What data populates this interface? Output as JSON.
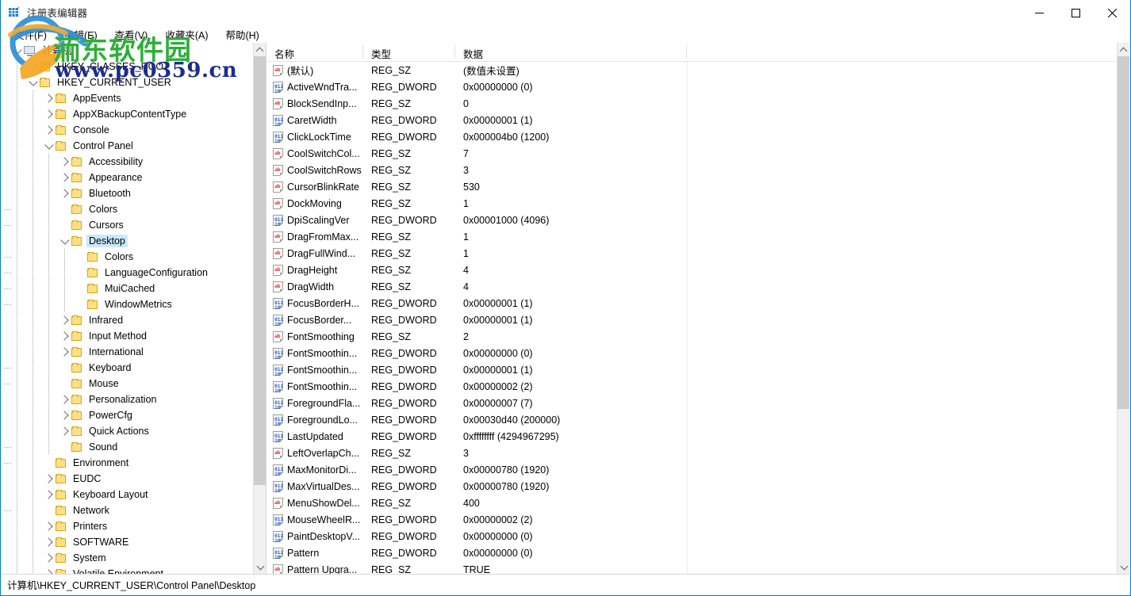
{
  "window": {
    "title": "注册表编辑器",
    "icon": "registry-icon",
    "minimize_label": "–",
    "maximize_label": "□",
    "close_label": "✕"
  },
  "menubar": {
    "items": [
      {
        "label": "文件(F)",
        "key": "F"
      },
      {
        "label": "编辑(E)",
        "key": "E"
      },
      {
        "label": "查看(V)",
        "key": "V"
      },
      {
        "label": "收藏夹(A)",
        "key": "A"
      },
      {
        "label": "帮助(H)",
        "key": "H"
      }
    ]
  },
  "tree": {
    "nodes": [
      {
        "label": "计算机",
        "depth": 0,
        "expander": "down",
        "icon": "computer-icon",
        "selected": false
      },
      {
        "label": "HKEY_CLASSES_ROOT",
        "depth": 1,
        "expander": "right",
        "icon": "folder-icon",
        "selected": false
      },
      {
        "label": "HKEY_CURRENT_USER",
        "depth": 1,
        "expander": "down",
        "icon": "folder-icon",
        "selected": false
      },
      {
        "label": "AppEvents",
        "depth": 2,
        "expander": "right",
        "icon": "folder-icon",
        "selected": false
      },
      {
        "label": "AppXBackupContentType",
        "depth": 2,
        "expander": "right",
        "icon": "folder-icon",
        "selected": false
      },
      {
        "label": "Console",
        "depth": 2,
        "expander": "right",
        "icon": "folder-icon",
        "selected": false
      },
      {
        "label": "Control Panel",
        "depth": 2,
        "expander": "down",
        "icon": "folder-icon",
        "selected": false
      },
      {
        "label": "Accessibility",
        "depth": 3,
        "expander": "right",
        "icon": "folder-icon",
        "selected": false
      },
      {
        "label": "Appearance",
        "depth": 3,
        "expander": "right",
        "icon": "folder-icon",
        "selected": false
      },
      {
        "label": "Bluetooth",
        "depth": 3,
        "expander": "right",
        "icon": "folder-icon",
        "selected": false
      },
      {
        "label": "Colors",
        "depth": 3,
        "expander": "none",
        "icon": "folder-icon",
        "selected": false
      },
      {
        "label": "Cursors",
        "depth": 3,
        "expander": "none",
        "icon": "folder-icon",
        "selected": false
      },
      {
        "label": "Desktop",
        "depth": 3,
        "expander": "down",
        "icon": "folder-icon",
        "selected": true
      },
      {
        "label": "Colors",
        "depth": 4,
        "expander": "none",
        "icon": "folder-icon",
        "selected": false
      },
      {
        "label": "LanguageConfiguration",
        "depth": 4,
        "expander": "none",
        "icon": "folder-icon",
        "selected": false
      },
      {
        "label": "MuiCached",
        "depth": 4,
        "expander": "none",
        "icon": "folder-icon",
        "selected": false
      },
      {
        "label": "WindowMetrics",
        "depth": 4,
        "expander": "none",
        "icon": "folder-icon",
        "selected": false
      },
      {
        "label": "Infrared",
        "depth": 3,
        "expander": "right",
        "icon": "folder-icon",
        "selected": false
      },
      {
        "label": "Input Method",
        "depth": 3,
        "expander": "right",
        "icon": "folder-icon",
        "selected": false
      },
      {
        "label": "International",
        "depth": 3,
        "expander": "right",
        "icon": "folder-icon",
        "selected": false
      },
      {
        "label": "Keyboard",
        "depth": 3,
        "expander": "none",
        "icon": "folder-icon",
        "selected": false
      },
      {
        "label": "Mouse",
        "depth": 3,
        "expander": "none",
        "icon": "folder-icon",
        "selected": false
      },
      {
        "label": "Personalization",
        "depth": 3,
        "expander": "right",
        "icon": "folder-icon",
        "selected": false
      },
      {
        "label": "PowerCfg",
        "depth": 3,
        "expander": "right",
        "icon": "folder-icon",
        "selected": false
      },
      {
        "label": "Quick Actions",
        "depth": 3,
        "expander": "right",
        "icon": "folder-icon",
        "selected": false
      },
      {
        "label": "Sound",
        "depth": 3,
        "expander": "none",
        "icon": "folder-icon",
        "selected": false
      },
      {
        "label": "Environment",
        "depth": 2,
        "expander": "none",
        "icon": "folder-icon",
        "selected": false
      },
      {
        "label": "EUDC",
        "depth": 2,
        "expander": "right",
        "icon": "folder-icon",
        "selected": false
      },
      {
        "label": "Keyboard Layout",
        "depth": 2,
        "expander": "right",
        "icon": "folder-icon",
        "selected": false
      },
      {
        "label": "Network",
        "depth": 2,
        "expander": "none",
        "icon": "folder-icon",
        "selected": false
      },
      {
        "label": "Printers",
        "depth": 2,
        "expander": "right",
        "icon": "folder-icon",
        "selected": false
      },
      {
        "label": "SOFTWARE",
        "depth": 2,
        "expander": "right",
        "icon": "folder-icon",
        "selected": false
      },
      {
        "label": "System",
        "depth": 2,
        "expander": "right",
        "icon": "folder-icon",
        "selected": false
      },
      {
        "label": "Volatile Environment",
        "depth": 2,
        "expander": "right",
        "icon": "folder-icon",
        "selected": false
      }
    ],
    "scroll_thumb_pct": 85
  },
  "list": {
    "columns": [
      {
        "label": "名称"
      },
      {
        "label": "类型"
      },
      {
        "label": "数据"
      },
      {
        "label": ""
      }
    ],
    "rows": [
      {
        "name": "(默认)",
        "type": "REG_SZ",
        "data": "(数值未设置)",
        "icon": "string-value-icon"
      },
      {
        "name": "ActiveWndTra...",
        "type": "REG_DWORD",
        "data": "0x00000000 (0)",
        "icon": "dword-value-icon"
      },
      {
        "name": "BlockSendInp...",
        "type": "REG_SZ",
        "data": "0",
        "icon": "string-value-icon"
      },
      {
        "name": "CaretWidth",
        "type": "REG_DWORD",
        "data": "0x00000001 (1)",
        "icon": "dword-value-icon"
      },
      {
        "name": "ClickLockTime",
        "type": "REG_DWORD",
        "data": "0x000004b0 (1200)",
        "icon": "dword-value-icon"
      },
      {
        "name": "CoolSwitchCol...",
        "type": "REG_SZ",
        "data": "7",
        "icon": "string-value-icon"
      },
      {
        "name": "CoolSwitchRows",
        "type": "REG_SZ",
        "data": "3",
        "icon": "string-value-icon"
      },
      {
        "name": "CursorBlinkRate",
        "type": "REG_SZ",
        "data": "530",
        "icon": "string-value-icon"
      },
      {
        "name": "DockMoving",
        "type": "REG_SZ",
        "data": "1",
        "icon": "string-value-icon"
      },
      {
        "name": "DpiScalingVer",
        "type": "REG_DWORD",
        "data": "0x00001000 (4096)",
        "icon": "dword-value-icon"
      },
      {
        "name": "DragFromMax...",
        "type": "REG_SZ",
        "data": "1",
        "icon": "string-value-icon"
      },
      {
        "name": "DragFullWind...",
        "type": "REG_SZ",
        "data": "1",
        "icon": "string-value-icon"
      },
      {
        "name": "DragHeight",
        "type": "REG_SZ",
        "data": "4",
        "icon": "string-value-icon"
      },
      {
        "name": "DragWidth",
        "type": "REG_SZ",
        "data": "4",
        "icon": "string-value-icon"
      },
      {
        "name": "FocusBorderH...",
        "type": "REG_DWORD",
        "data": "0x00000001 (1)",
        "icon": "dword-value-icon"
      },
      {
        "name": "FocusBorder...",
        "type": "REG_DWORD",
        "data": "0x00000001 (1)",
        "icon": "dword-value-icon"
      },
      {
        "name": "FontSmoothing",
        "type": "REG_SZ",
        "data": "2",
        "icon": "string-value-icon"
      },
      {
        "name": "FontSmoothin...",
        "type": "REG_DWORD",
        "data": "0x00000000 (0)",
        "icon": "dword-value-icon"
      },
      {
        "name": "FontSmoothin...",
        "type": "REG_DWORD",
        "data": "0x00000001 (1)",
        "icon": "dword-value-icon"
      },
      {
        "name": "FontSmoothin...",
        "type": "REG_DWORD",
        "data": "0x00000002 (2)",
        "icon": "dword-value-icon"
      },
      {
        "name": "ForegroundFla...",
        "type": "REG_DWORD",
        "data": "0x00000007 (7)",
        "icon": "dword-value-icon"
      },
      {
        "name": "ForegroundLo...",
        "type": "REG_DWORD",
        "data": "0x00030d40 (200000)",
        "icon": "dword-value-icon"
      },
      {
        "name": "LastUpdated",
        "type": "REG_DWORD",
        "data": "0xffffffff (4294967295)",
        "icon": "dword-value-icon"
      },
      {
        "name": "LeftOverlapCh...",
        "type": "REG_SZ",
        "data": "3",
        "icon": "string-value-icon"
      },
      {
        "name": "MaxMonitorDi...",
        "type": "REG_DWORD",
        "data": "0x00000780 (1920)",
        "icon": "dword-value-icon"
      },
      {
        "name": "MaxVirtualDes...",
        "type": "REG_DWORD",
        "data": "0x00000780 (1920)",
        "icon": "dword-value-icon"
      },
      {
        "name": "MenuShowDel...",
        "type": "REG_SZ",
        "data": "400",
        "icon": "string-value-icon"
      },
      {
        "name": "MouseWheelR...",
        "type": "REG_DWORD",
        "data": "0x00000002 (2)",
        "icon": "dword-value-icon"
      },
      {
        "name": "PaintDesktopV...",
        "type": "REG_DWORD",
        "data": "0x00000000 (0)",
        "icon": "dword-value-icon"
      },
      {
        "name": "Pattern",
        "type": "REG_DWORD",
        "data": "0x00000000 (0)",
        "icon": "dword-value-icon"
      },
      {
        "name": "Pattern Upgra...",
        "type": "REG_SZ",
        "data": "TRUE",
        "icon": "string-value-icon"
      }
    ],
    "scroll_thumb_pct": 70
  },
  "status": {
    "path": "计算机\\HKEY_CURRENT_USER\\Control Panel\\Desktop"
  },
  "watermark": {
    "green_text": "洏东软件园",
    "blue_text": "www.pc0359.cn",
    "green_color": "#2fae3a",
    "blue_color": "#1b2e8c"
  },
  "theme": {
    "accent": "#0078d7",
    "selection": "#cce8ff",
    "scrollbar_thumb": "#cdcdcd"
  }
}
